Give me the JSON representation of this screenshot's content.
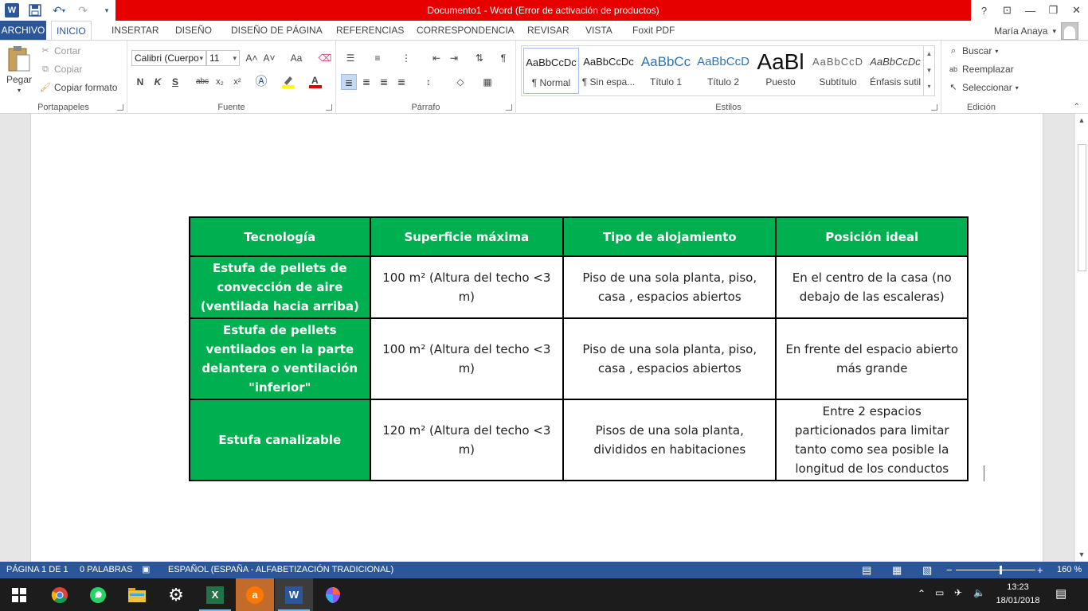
{
  "titlebar": {
    "title": "Documento1 -  Word (Error de activación de productos)",
    "help": "?",
    "restore_ribbon": "⊡",
    "minimize": "—",
    "maximize": "❐",
    "close": "✕"
  },
  "tabs": {
    "file": "ARCHIVO",
    "items": [
      "INICIO",
      "INSERTAR",
      "DISEÑO",
      "DISEÑO DE PÁGINA",
      "REFERENCIAS",
      "CORRESPONDENCIA",
      "REVISAR",
      "VISTA",
      "Foxit PDF"
    ]
  },
  "user": {
    "name": "María Anaya"
  },
  "clipboard": {
    "paste": "Pegar",
    "cut": "Cortar",
    "copy": "Copiar",
    "format_painter": "Copiar formato",
    "label": "Portapapeles"
  },
  "font": {
    "family": "Calibri (Cuerpo",
    "size": "11",
    "label": "Fuente",
    "bold": "N",
    "italic": "K",
    "underline": "S",
    "strike": "abc",
    "subscript": "x₂",
    "superscript": "x²",
    "grow": "A˄",
    "shrink": "A˅",
    "case": "Aa",
    "highlight_color": "#ffff00",
    "font_color": "#e00000"
  },
  "paragraph": {
    "label": "Párrafo",
    "pilcrow": "¶"
  },
  "styles": {
    "label": "Estilos",
    "items": [
      {
        "sample": "AaBbCcDc",
        "name": "¶ Normal"
      },
      {
        "sample": "AaBbCcDc",
        "name": "¶ Sin espa..."
      },
      {
        "sample": "AaBbCc",
        "name": "Título 1"
      },
      {
        "sample": "AaBbCcD",
        "name": "Título 2"
      },
      {
        "sample": "AaBl",
        "name": "Puesto"
      },
      {
        "sample": "AaBbCcD",
        "name": "Subtítulo"
      },
      {
        "sample": "AaBbCcDc",
        "name": "Énfasis sutil"
      }
    ]
  },
  "editing": {
    "label": "Edición",
    "find": "Buscar",
    "replace": "Reemplazar",
    "select": "Seleccionar"
  },
  "table": {
    "headers": [
      "Tecnología",
      "Superficie máxima",
      "Tipo de alojamiento",
      "Posición ideal"
    ],
    "rows": [
      [
        "Estufa de pellets de convección de aire (ventilada hacia arriba)",
        "100 m²  (Altura del techo <3 m)",
        "Piso de una sola planta, piso, casa , espacios abiertos",
        "En el centro de la casa (no debajo de las escaleras)"
      ],
      [
        "Estufa de pellets ventilados en la parte delantera o ventilación \"inferior\"",
        "100 m²  (Altura del techo <3 m)",
        "Piso de una sola planta, piso, casa , espacios abiertos",
        "En frente del espacio abierto más grande"
      ],
      [
        "Estufa canalizable",
        "120 m²  (Altura del techo <3 m)",
        "Pisos de una sola planta, divididos en habitaciones",
        "Entre 2 espacios particionados para limitar tanto como sea posible la longitud de los conductos"
      ]
    ],
    "header_color": "#00b050"
  },
  "status": {
    "page": "PÁGINA 1 DE 1",
    "words": "0 PALABRAS",
    "language": "ESPAÑOL (ESPAÑA - ALFABETIZACIÓN TRADICIONAL)",
    "zoom": "160 %",
    "zoom_percent": 160
  },
  "taskbar": {
    "time": "13:23",
    "date": "18/01/2018"
  }
}
